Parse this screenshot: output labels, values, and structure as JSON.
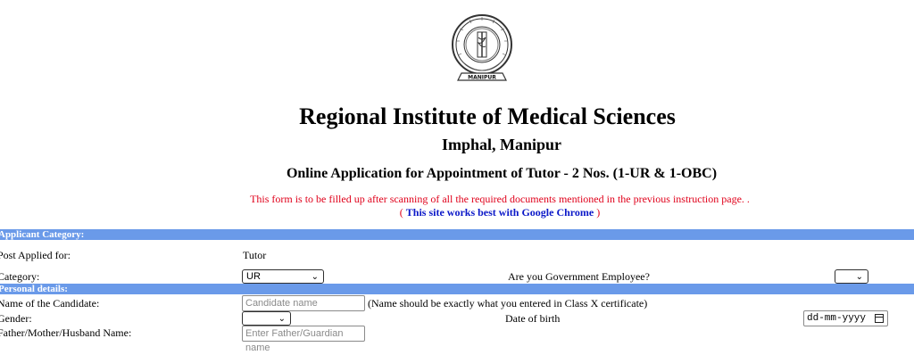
{
  "header": {
    "logo_text_ring": "REGIONAL INSTITUTE OF MEDICAL SCIENCES",
    "logo_banner": "MANIPUR",
    "logo_inner": "IMPHAL",
    "institute_name": "Regional Institute of Medical Sciences",
    "location": "Imphal, Manipur",
    "application_title": "Online Application for Appointment of Tutor - 2 Nos. (1-UR & 1-OBC)",
    "notice_line1": "This form is to be filled up after scanning of all the required documents mentioned in the previous instruction page. .",
    "notice_line2_prefix": "( ",
    "notice_line2_bold": "This site works best with Google Chrome",
    "notice_line2_suffix": " )"
  },
  "sections": {
    "applicant_category": "Applicant Category:",
    "personal_details": "Personal details:"
  },
  "form": {
    "post_applied_label": "Post Applied for:",
    "post_applied_value": "Tutor",
    "category_label": "Category:",
    "category_selected": "UR",
    "govt_employee_label": "Are you Government Employee?",
    "govt_employee_selected": "",
    "candidate_name_label": "Name of the Candidate:",
    "candidate_name_placeholder": "Candidate name",
    "candidate_name_note": "(Name should be exactly what you entered in Class X certificate)",
    "gender_label": "Gender:",
    "gender_selected": "",
    "dob_label": "Date of  birth",
    "dob_placeholder": "dd-mm-yyyy",
    "father_label": "Father/Mother/Husband Name:",
    "father_placeholder": "Enter Father/Guardian name"
  },
  "icons": {
    "dropdown": "chevron-down-icon",
    "calendar": "calendar-icon"
  },
  "colors": {
    "section_bar": "#6a9ae9",
    "notice_red": "#e0001a",
    "notice_blue": "#0b18c8"
  }
}
